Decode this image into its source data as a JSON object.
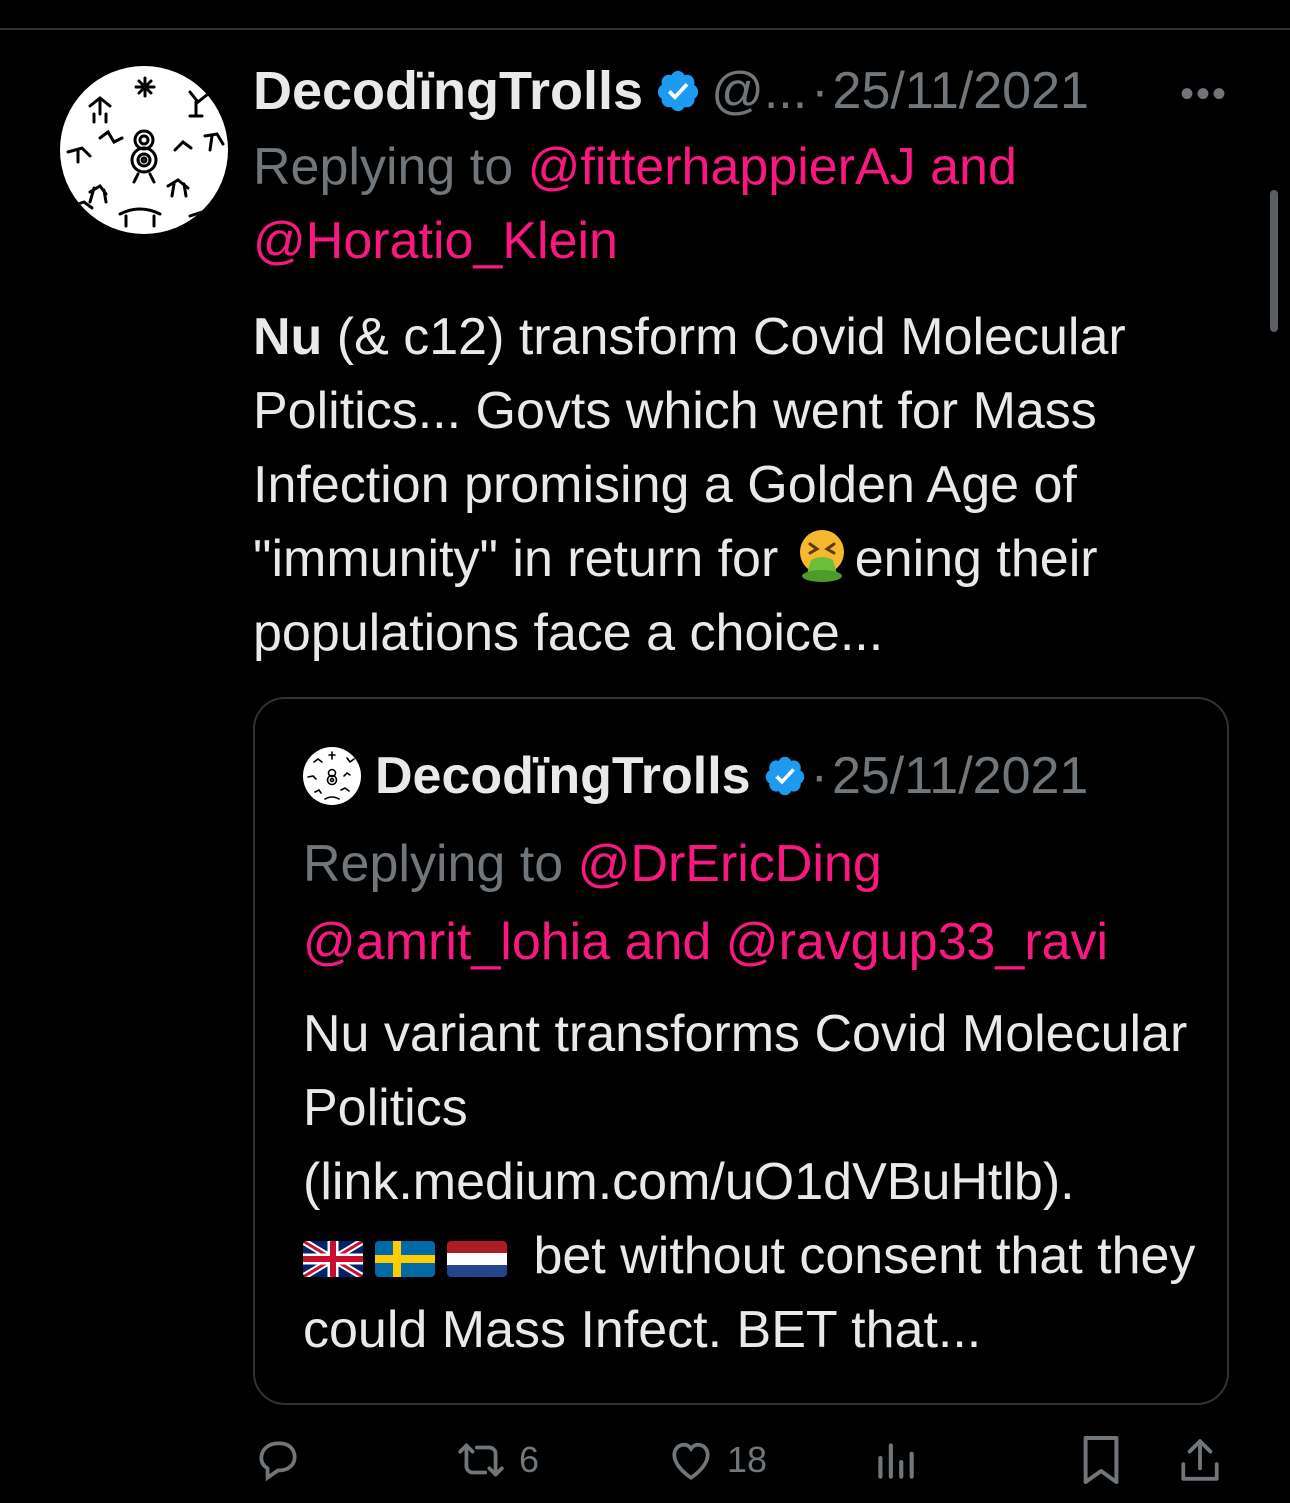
{
  "tweet": {
    "author_name": "DecodïngTrolls",
    "handle": "@...",
    "separator": "·",
    "date": "25/11/2021",
    "replying_prefix": "Replying to ",
    "reply_mention_1": "@fitterhappierAJ",
    "reply_and": " and",
    "reply_mention_2": "@Horatio_Klein",
    "text_bold": "Nu",
    "text_part1": " (& c12) transform Covid Molecular Politics... Govts which went for Mass Infection promising a Golden Age of \"immunity\" in return for ",
    "emoji": "nauseated-face-emoji",
    "text_part2": "ening their populations face a choice..."
  },
  "quote": {
    "author_name": "DecodïngTrolls",
    "separator": "·",
    "date": "25/11/2021",
    "replying_prefix": "Replying to ",
    "mention_1": "@DrEricDing",
    "mention_2": "@amrit_lohia",
    "and_text": " and ",
    "mention_3": "@ravgup33_ravi",
    "text_part1": "Nu variant transforms Covid Molecular Politics (link.medium.com/uO1dVBuHtlb).",
    "flags": [
      "uk-flag",
      "sweden-flag",
      "netherlands-flag"
    ],
    "text_part2": " bet without consent that they could Mass Infect. BET that..."
  },
  "actions": {
    "reply_icon": "reply-icon",
    "retweet_icon": "retweet-icon",
    "retweet_count": "6",
    "like_icon": "like-icon",
    "like_count": "18",
    "views_icon": "views-icon",
    "bookmark_icon": "bookmark-icon",
    "share_icon": "share-icon"
  },
  "colors": {
    "background": "#000000",
    "text": "#e7e9ea",
    "muted": "#71767b",
    "mention": "#f91880",
    "verified": "#1d9bf0",
    "border": "#2f3336"
  }
}
